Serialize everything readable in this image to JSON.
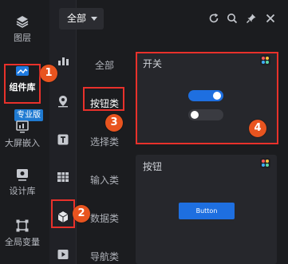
{
  "main_sidebar": {
    "items": [
      {
        "label": "图层",
        "icon": "layers-icon"
      },
      {
        "label": "组件库",
        "icon": "component-library-icon",
        "active": true
      },
      {
        "label": "大屏嵌入",
        "icon": "screen-embed-icon"
      },
      {
        "label": "设计库",
        "icon": "design-library-icon"
      },
      {
        "label": "全局变量",
        "icon": "global-variables-icon"
      }
    ],
    "pro_badge": "专业版"
  },
  "sub_sidebar": {
    "icons": [
      "bar-chart-icon",
      "map-pin-icon",
      "text-icon",
      "table-icon",
      "cube-icon",
      "video-icon"
    ]
  },
  "header": {
    "scope_select": "全部",
    "icons": [
      "refresh-icon",
      "search-icon",
      "pin-icon",
      "close-icon"
    ]
  },
  "categories": [
    {
      "label": "全部"
    },
    {
      "label": "按钮类",
      "active": true
    },
    {
      "label": "选择类"
    },
    {
      "label": "输入类"
    },
    {
      "label": "数据类"
    },
    {
      "label": "导航类"
    }
  ],
  "cards": {
    "switch": {
      "title": "开关"
    },
    "button": {
      "title": "按钮",
      "preview_label": "Button"
    }
  },
  "annotations": {
    "marker_1": "1",
    "marker_2": "2",
    "marker_3": "3",
    "marker_4": "4",
    "highlight_color": "#e8312b",
    "marker_color": "#e8541f"
  },
  "colors": {
    "accent": "#1e6fe0",
    "background": "#1b1c1f",
    "card": "#26272c"
  }
}
